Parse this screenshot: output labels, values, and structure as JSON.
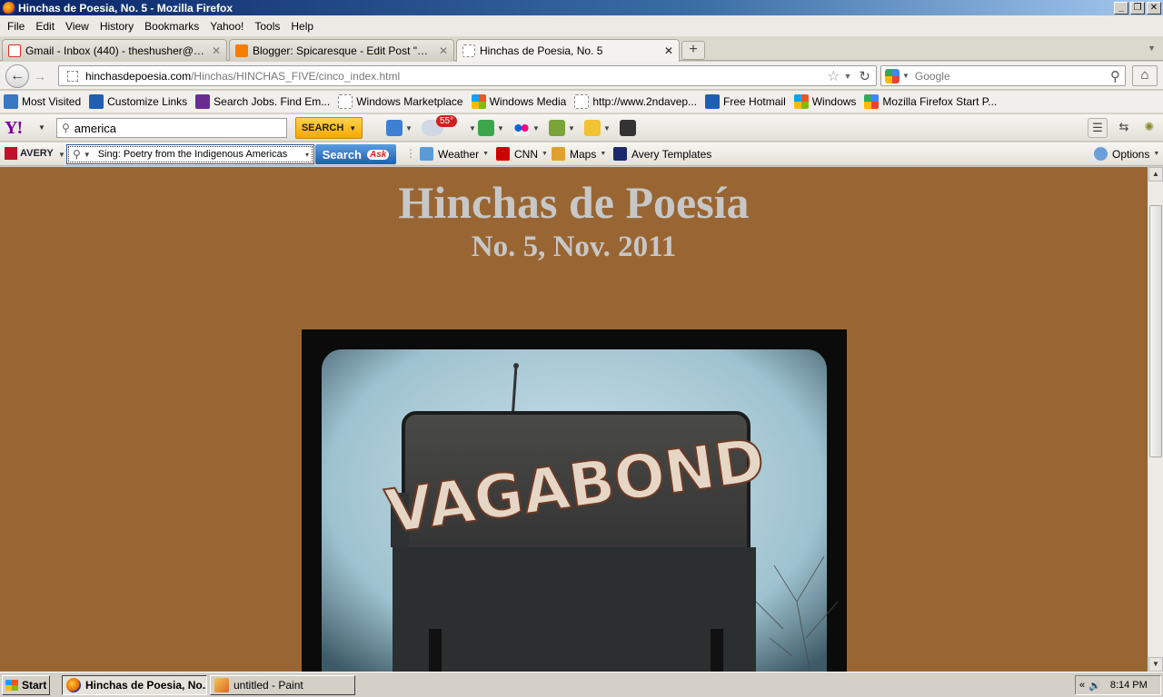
{
  "window": {
    "title": "Hinchas de Poesia, No. 5 - Mozilla Firefox",
    "controls": [
      "_",
      "❐",
      "✕"
    ]
  },
  "menu": [
    "File",
    "Edit",
    "View",
    "History",
    "Bookmarks",
    "Yahoo!",
    "Tools",
    "Help"
  ],
  "tabs": [
    {
      "label": "Gmail - Inbox (440) - theshusher@gmail....",
      "icon": "gmail-icon",
      "color": "#d93025"
    },
    {
      "label": "Blogger: Spicaresque - Edit Post \"CINCO ...",
      "icon": "blogger-icon",
      "color": "#f57d00"
    },
    {
      "label": "Hinchas de Poesia, No. 5",
      "icon": "blank-page-icon",
      "color": "#ffffff"
    }
  ],
  "new_tab": "+",
  "nav": {
    "back": "←",
    "forward": "→",
    "url_domain": "hinchasdepoesia.com",
    "url_path": "/Hinchas/HINCHAS_FIVE/cinco_index.html",
    "search_placeholder": "Google",
    "home": "⌂"
  },
  "bookmarks": [
    {
      "label": "Most Visited",
      "icon": "most-visited-icon",
      "color": "#3a78c2"
    },
    {
      "label": "Customize Links",
      "icon": "msn-icon",
      "color": "#1e5fb3"
    },
    {
      "label": "Search Jobs. Find Em...",
      "icon": "monster-icon",
      "color": "#6a2c91"
    },
    {
      "label": "Windows Marketplace",
      "icon": "blank-page-icon",
      "color": "#ffffff"
    },
    {
      "label": "Windows Media",
      "icon": "windows-flag-icon",
      "color": "#f35325"
    },
    {
      "label": "http://www.2ndavep...",
      "icon": "blank-page-icon",
      "color": "#ffffff"
    },
    {
      "label": "Free Hotmail",
      "icon": "msn-icon",
      "color": "#1e5fb3"
    },
    {
      "label": "Windows",
      "icon": "windows-flag-icon",
      "color": "#81bc06"
    },
    {
      "label": "Mozilla Firefox Start P...",
      "icon": "google-icon",
      "color": "#4285f4"
    }
  ],
  "yahoo": {
    "logo": "Y!",
    "search_value": "america",
    "search_button": "SEARCH",
    "weather_temp": "55°"
  },
  "avery": {
    "logo": "AVERY",
    "search_value": "Sing: Poetry from the Indigenous Americas",
    "search_button": "Search",
    "ask_logo": "Ask",
    "items": [
      {
        "label": "Weather",
        "icon": "weather-icon",
        "color": "#5b9bd5"
      },
      {
        "label": "CNN",
        "icon": "cnn-icon",
        "color": "#cc0000"
      },
      {
        "label": "Maps",
        "icon": "maps-icon",
        "color": "#e0a030"
      },
      {
        "label": "Avery Templates",
        "icon": "avery-icon",
        "color": "#1c2a6b"
      }
    ],
    "options": "Options"
  },
  "page": {
    "title": "Hinchas de Poesía",
    "subtitle": "No. 5, Nov. 2011",
    "photo_sign_text": "VAGABOND",
    "background_color": "#996633",
    "title_color": "#c7c7c7"
  },
  "taskbar": {
    "start": "Start",
    "buttons": [
      {
        "label": "Hinchas de Poesia, No...",
        "icon": "firefox-icon",
        "active": true
      },
      {
        "label": "untitled - Paint",
        "icon": "paint-icon",
        "active": false
      }
    ],
    "clock": "8:14 PM"
  }
}
